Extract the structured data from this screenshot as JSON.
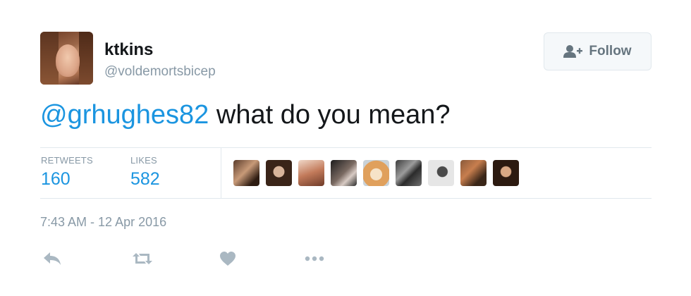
{
  "user": {
    "display_name": "ktkins",
    "handle": "@voldemortsbicep"
  },
  "follow_button": {
    "label": "Follow",
    "icon": "add-user-icon"
  },
  "tweet": {
    "mention": "@grhughes82",
    "text": " what do you mean?"
  },
  "stats": {
    "retweets_label": "RETWEETS",
    "retweets_value": "160",
    "likes_label": "LIKES",
    "likes_value": "582"
  },
  "likers": [
    {
      "name": "liker-avatar-1"
    },
    {
      "name": "liker-avatar-2"
    },
    {
      "name": "liker-avatar-3"
    },
    {
      "name": "liker-avatar-4"
    },
    {
      "name": "liker-avatar-5"
    },
    {
      "name": "liker-avatar-6"
    },
    {
      "name": "liker-avatar-7"
    },
    {
      "name": "liker-avatar-8"
    },
    {
      "name": "liker-avatar-9"
    }
  ],
  "timestamp": "7:43 AM - 12 Apr 2016",
  "actions": [
    "reply-icon",
    "retweet-icon",
    "like-icon",
    "more-icon"
  ],
  "colors": {
    "accent": "#1b95e0",
    "muted": "#8899a6",
    "text": "#14171a",
    "border": "#e1e8ed"
  }
}
